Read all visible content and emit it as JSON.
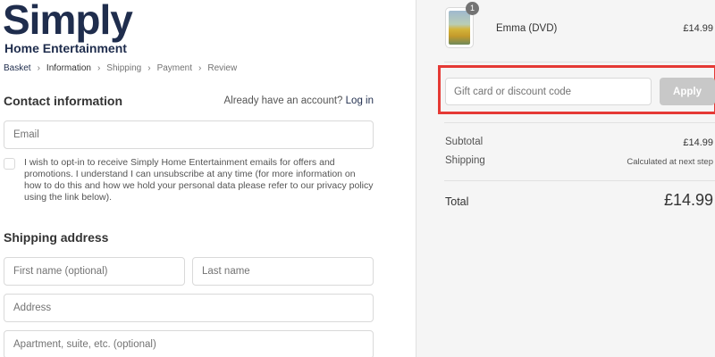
{
  "brand": {
    "name": "Simply",
    "subtitle": "Home Entertainment"
  },
  "breadcrumb": [
    {
      "label": "Basket",
      "state": "link"
    },
    {
      "label": "Information",
      "state": "current"
    },
    {
      "label": "Shipping",
      "state": "upcoming"
    },
    {
      "label": "Payment",
      "state": "upcoming"
    },
    {
      "label": "Review",
      "state": "upcoming"
    }
  ],
  "contact": {
    "title": "Contact information",
    "login_prompt": "Already have an account?",
    "login_link": "Log in",
    "email_placeholder": "Email",
    "optin_text": "I wish to opt-in to receive Simply Home Entertainment emails for offers and promotions. I understand I can unsubscribe at any time (for more information on how to do this and how we hold your personal data please refer to our privacy policy using the link below)."
  },
  "shipping": {
    "title": "Shipping address",
    "first_name_placeholder": "First name (optional)",
    "last_name_placeholder": "Last name",
    "address_placeholder": "Address",
    "apartment_placeholder": "Apartment, suite, etc. (optional)"
  },
  "order": {
    "item": {
      "name": "Emma (DVD)",
      "quantity": "1",
      "price": "£14.99"
    },
    "discount": {
      "placeholder": "Gift card or discount code",
      "apply_label": "Apply"
    },
    "subtotal_label": "Subtotal",
    "subtotal_value": "£14.99",
    "shipping_label": "Shipping",
    "shipping_value": "Calculated at next step",
    "total_label": "Total",
    "total_value": "£14.99"
  },
  "colors": {
    "brand": "#1f2d4d",
    "highlight": "#e53935",
    "apply_button": "#c8c8c8",
    "sidebar_bg": "#f5f5f5"
  }
}
